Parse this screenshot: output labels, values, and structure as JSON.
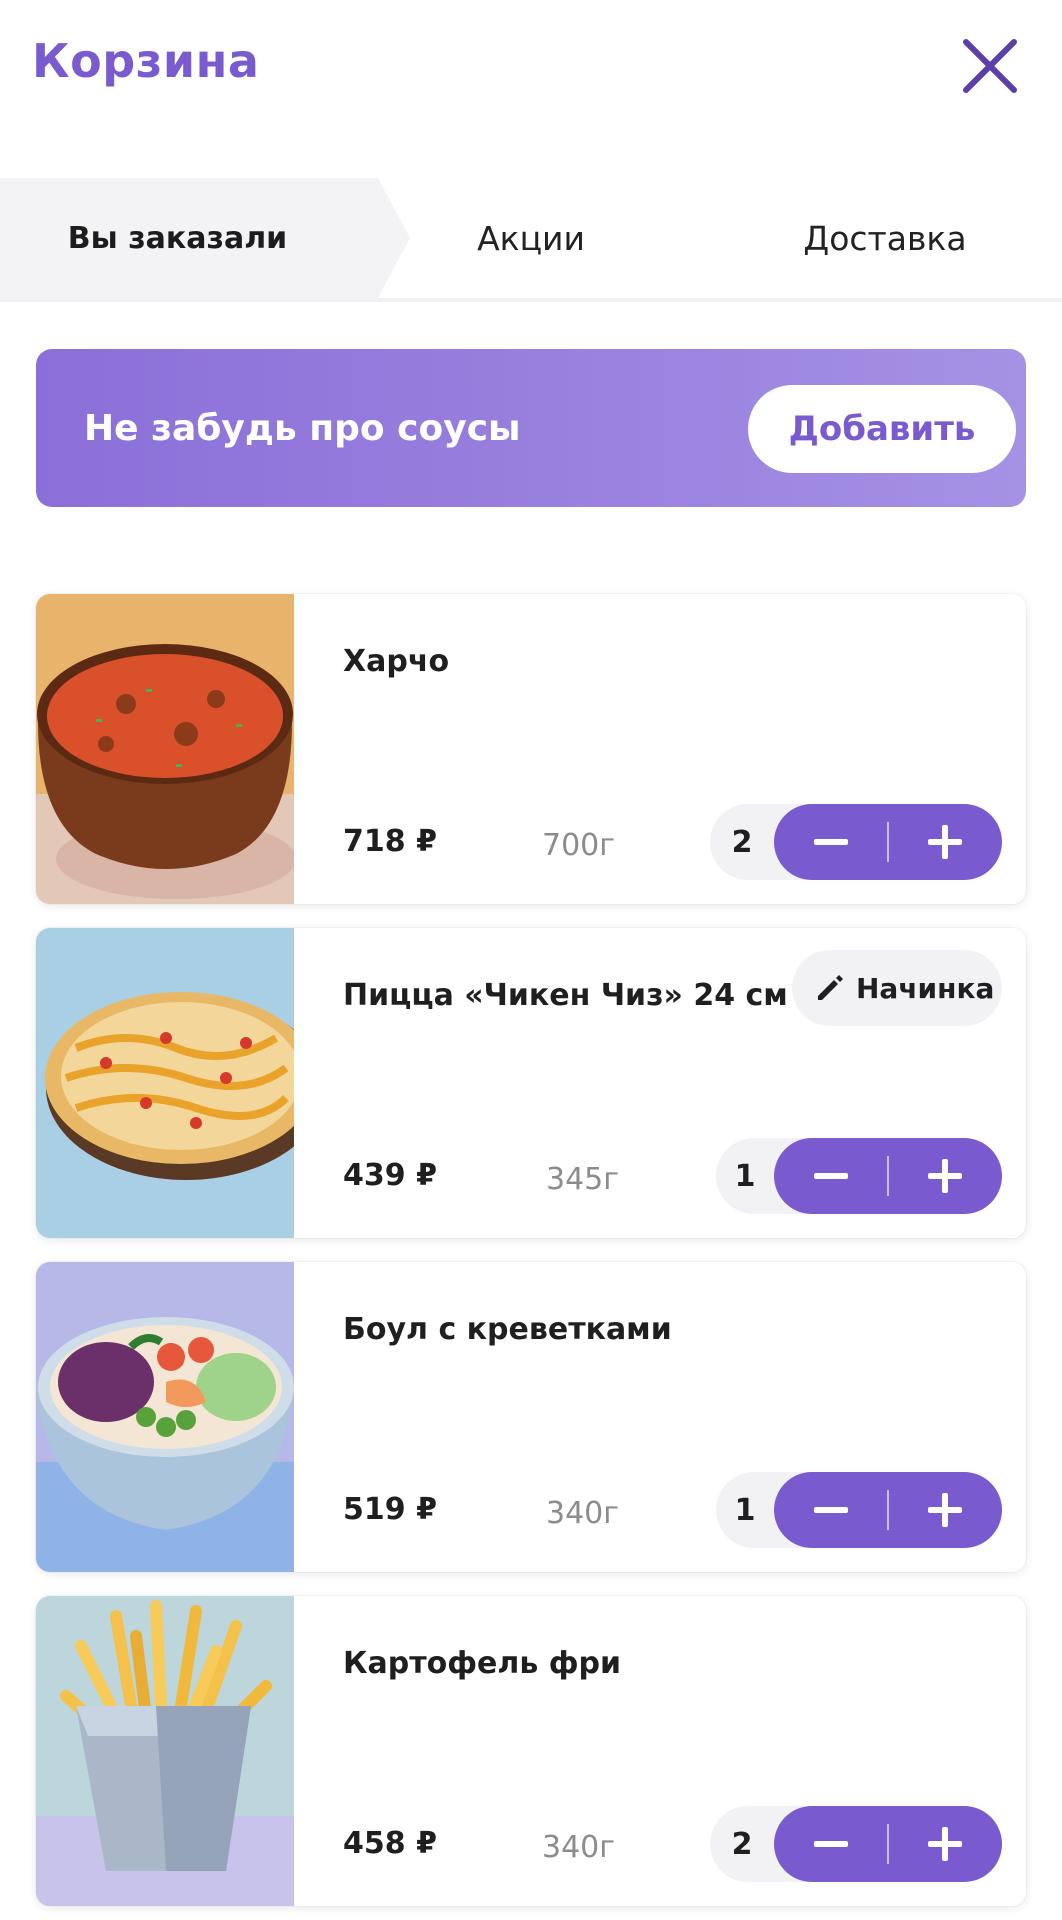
{
  "header": {
    "title": "Корзина",
    "close_icon": "close-icon"
  },
  "tabs": [
    {
      "label": "Вы заказали",
      "active": true
    },
    {
      "label": "Акции",
      "active": false
    },
    {
      "label": "Доставка",
      "active": false
    }
  ],
  "banner": {
    "text": "Не забудь про соусы",
    "button_label": "Добавить"
  },
  "colors": {
    "accent": "#7a5bcf",
    "banner_start": "#8b6fd8",
    "banner_end": "#a592e4"
  },
  "items": [
    {
      "name": "Харчо",
      "price": "718 ₽",
      "weight": "700г",
      "qty": "2",
      "image": "soup-bowl-image"
    },
    {
      "name": "Пицца «Чикен Чиз» 24 см",
      "price": "439 ₽",
      "weight": "345г",
      "qty": "1",
      "image": "pizza-image",
      "filling_label": "Начинка"
    },
    {
      "name": "Боул с креветками",
      "price": "519 ₽",
      "weight": "340г",
      "qty": "1",
      "image": "shrimp-bowl-image"
    },
    {
      "name": "Картофель фри",
      "price": "458 ₽",
      "weight": "340г",
      "qty": "2",
      "image": "french-fries-image"
    }
  ]
}
